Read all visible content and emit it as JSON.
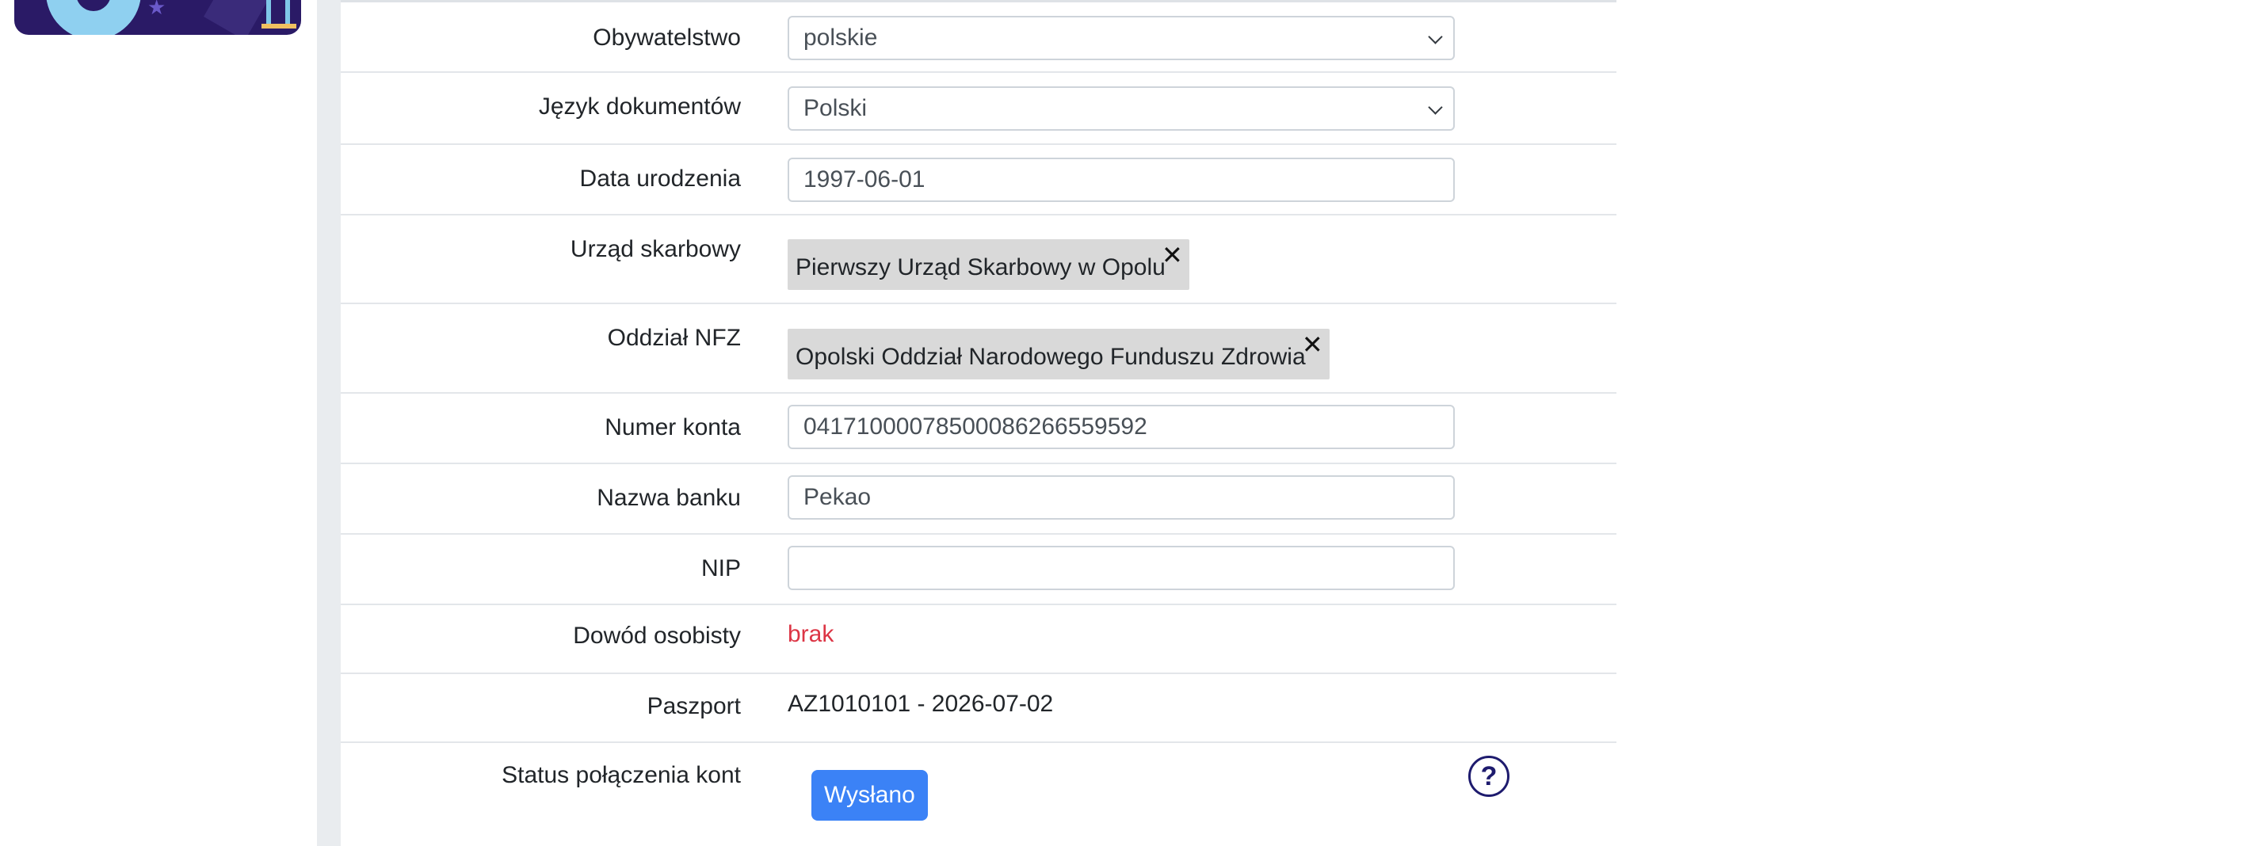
{
  "sidebar": {
    "banner_icons": [
      "gear-icon",
      "star-icon",
      "easel-icon"
    ]
  },
  "form": {
    "citizenship": {
      "label": "Obywatelstwo",
      "value": "polskie"
    },
    "documents_language": {
      "label": "Język dokumentów",
      "value": "Polski"
    },
    "birth_date": {
      "label": "Data urodzenia",
      "value": "1997-06-01"
    },
    "tax_office": {
      "label": "Urząd skarbowy",
      "value": "Pierwszy Urząd Skarbowy w Opolu",
      "remove": "✕"
    },
    "nfz_branch": {
      "label": "Oddział NFZ",
      "value": "Opolski Oddział Narodowego Funduszu Zdrowia",
      "remove": "✕"
    },
    "account_number": {
      "label": "Numer konta",
      "value": "04171000078500086266559592"
    },
    "bank_name": {
      "label": "Nazwa banku",
      "value": "Pekao"
    },
    "nip": {
      "label": "NIP",
      "value": ""
    },
    "id_card": {
      "label": "Dowód osobisty",
      "value": "brak"
    },
    "passport": {
      "label": "Paszport",
      "value": "AZ1010101 - 2026-07-02"
    },
    "account_link_status": {
      "label": "Status połączenia kont",
      "button": "Wysłano",
      "help": "?"
    }
  },
  "colors": {
    "accent": "#3b82f6",
    "danger": "#dc3545",
    "help": "#1e1b6e",
    "chip": "#d9d9d9"
  }
}
